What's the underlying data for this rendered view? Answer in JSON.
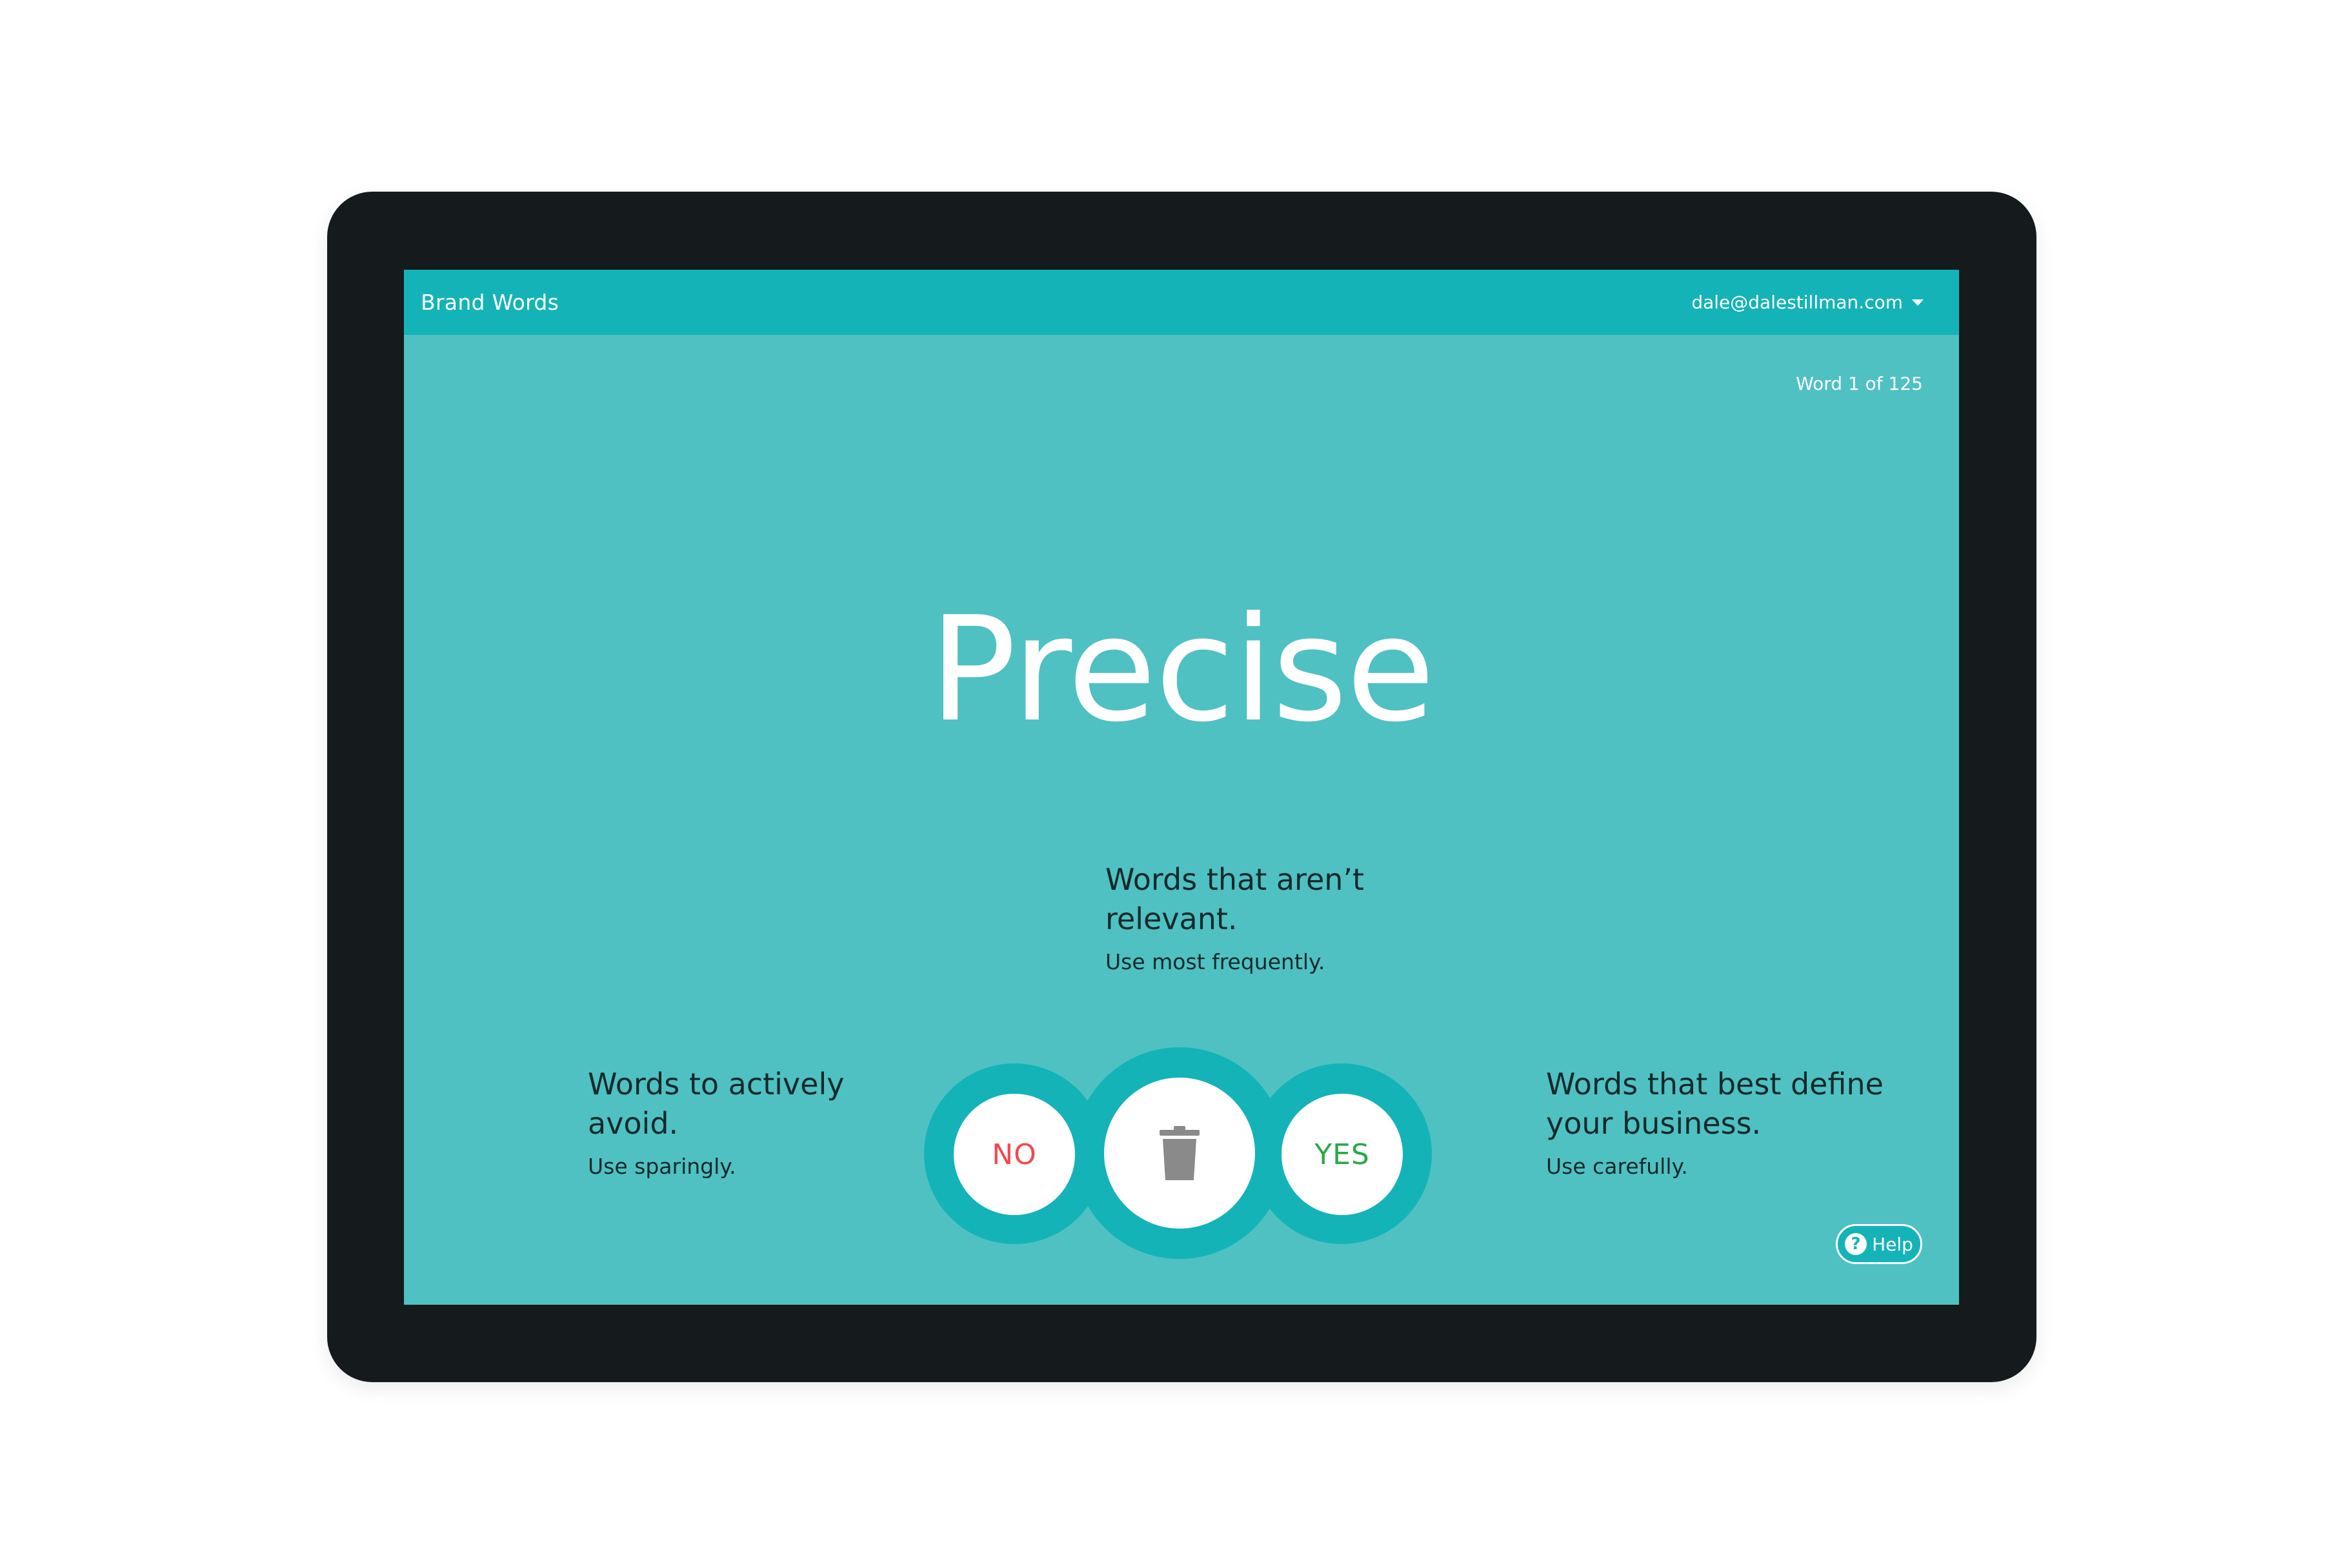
{
  "header": {
    "app_title": "Brand Words",
    "user_email": "dale@dalestillman.com"
  },
  "progress": {
    "counter_text": "Word 1 of 125"
  },
  "main": {
    "word": "Precise"
  },
  "hints": {
    "top": {
      "title": "Words that aren’t relevant.",
      "subtitle": "Use most frequently."
    },
    "left": {
      "title": "Words to actively avoid.",
      "subtitle": "Use sparingly."
    },
    "right": {
      "title": "Words that best define your business.",
      "subtitle": "Use carefully."
    }
  },
  "actions": {
    "no_label": "NO",
    "yes_label": "YES",
    "trash_icon": "trash-icon"
  },
  "help": {
    "label": "Help"
  },
  "colors": {
    "accent": "#14b3b8",
    "background": "#4fc1c2",
    "device_frame": "#151a1d",
    "no": "#ef4a4f",
    "yes": "#2aa84a",
    "trash": "#8a8a8a"
  }
}
